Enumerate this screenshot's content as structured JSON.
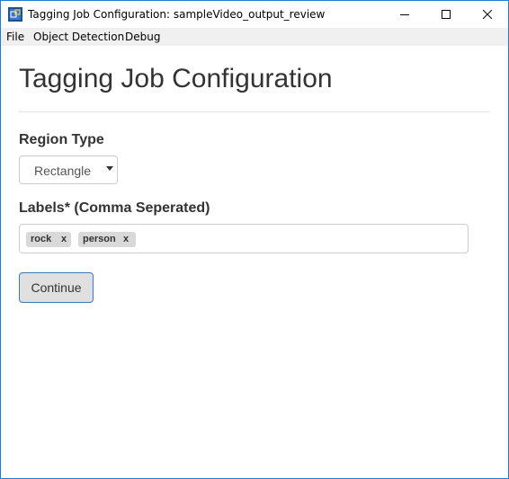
{
  "window": {
    "title": "Tagging Job Configuration: sampleVideo_output_review",
    "app_icon": "vott-app-icon",
    "controls": [
      "minimize-icon",
      "maximize-icon",
      "close-icon"
    ]
  },
  "menubar": {
    "items": [
      {
        "label": "File"
      },
      {
        "label": "Object Detection"
      },
      {
        "label": "Debug"
      }
    ]
  },
  "main": {
    "title": "Tagging Job Configuration",
    "region_type": {
      "label": "Region Type",
      "selected": "Rectangle",
      "caret_icon": "caret-down-icon"
    },
    "labels": {
      "label": "Labels* (Comma Seperated)",
      "tags": [
        {
          "text": "rock",
          "remove": "x"
        },
        {
          "text": "person",
          "remove": "x"
        }
      ]
    },
    "continue_label": "Continue"
  },
  "colors": {
    "window_border": "#1e7bd6",
    "menubar_bg": "#f0f0f0",
    "tag_bg": "#d9d9d9",
    "button_bg": "#e0e0e0",
    "button_border": "#3b79b6",
    "text": "#333333"
  }
}
